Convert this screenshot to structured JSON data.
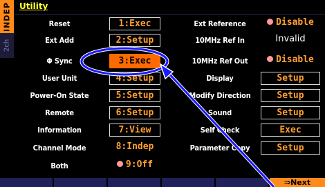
{
  "menu": {
    "title": "Utility"
  },
  "side": {
    "mode": "INDEP",
    "channel": "2ch"
  },
  "left_rows": [
    {
      "label": "Reset",
      "value": "1:Exec"
    },
    {
      "label": "Ext Add",
      "value": "2:Setup"
    },
    {
      "label": "Φ Sync",
      "value": "3:Exec"
    },
    {
      "label": "User Unit",
      "value": "4:Setup"
    },
    {
      "label": "Power-On State",
      "value": "5:Setup"
    },
    {
      "label": "Remote",
      "value": "6:Setup"
    },
    {
      "label": "Information",
      "value": "7:View"
    },
    {
      "label": "Channel Mode",
      "value": "8:Indep"
    },
    {
      "label": "Both",
      "value": "9:Off"
    }
  ],
  "right_rows": [
    {
      "label": "Ext Reference",
      "value": "Disable"
    },
    {
      "label": "10MHz Ref In",
      "value": "Invalid"
    },
    {
      "label": "10MHz Ref Out",
      "value": "Disable"
    },
    {
      "label": "Display",
      "value": "Setup"
    },
    {
      "label": "Modify Direction",
      "value": "Setup"
    },
    {
      "label": "Sound",
      "value": "Setup"
    },
    {
      "label": "Self Check",
      "value": "Exec"
    },
    {
      "label": "Parameter Copy",
      "value": "Setup"
    }
  ],
  "softkeys": {
    "next_label": "⇒Next"
  },
  "colors": {
    "accent_orange": "#ff6a00",
    "value_orange": "#ffa030",
    "label_white": "#ffffff",
    "title_yellow": "#ffff33",
    "radio_pink": "#ff9a9a",
    "softkey_navy": "#20205a",
    "annotation_blue": "#1a1aff"
  }
}
